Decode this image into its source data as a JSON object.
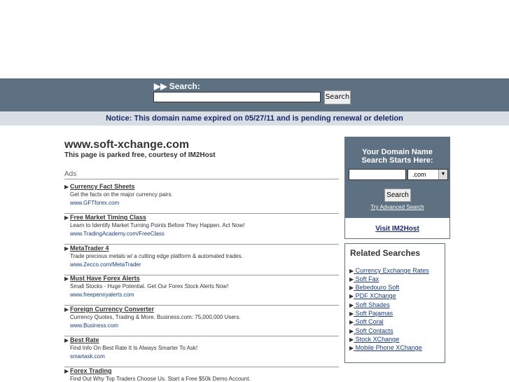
{
  "search": {
    "label": "▶▶ Search:",
    "input_value": "",
    "button_label": "Search"
  },
  "notice": "Notice: This domain name expired on 05/27/11 and is pending renewal or deletion",
  "site": {
    "title": "www.soft-xchange.com",
    "subtitle": "This page is parked free, courtesy of IM2Host"
  },
  "ads": {
    "label": "Ads",
    "items": [
      {
        "title": "Currency Fact Sheets",
        "desc": "Get the facts on the major currency pairs.",
        "url": "www.GFTforex.com"
      },
      {
        "title": "Free Market Timing Class",
        "desc": "Learn to Identify Market Turning Points Before They Happen. Act Now!",
        "url": "www.TradingAcademy.com/FreeClass"
      },
      {
        "title": "MetaTrader 4",
        "desc": "Trade precious metals w/ a cutting edge platform & automated trades.",
        "url": "www.Zecco.com/MetaTrader"
      },
      {
        "title": "Must Have Forex Alerts",
        "desc": "Small Stocks - Huge Potential. Get Our Forex Stock Alerts Now!",
        "url": "www.freepennyalerts.com"
      },
      {
        "title": "Foreign Currency Converter",
        "desc": "Currency Quotes, Trading & More. Business.com: 75,000,000 Users.",
        "url": "www.Business.com"
      },
      {
        "title": "Best Rate",
        "desc": "Find Info On Best Rate It Is Always Smarter To Ask!",
        "url": "smartask.com"
      },
      {
        "title": "Forex Trading",
        "desc": "Find Out Why Top Traders Choose Us. Start a Free $50k Demo Account.",
        "url": ""
      }
    ]
  },
  "domain_box": {
    "heading_line1": "Your Domain Name",
    "heading_line2": "Search Starts Here:",
    "input_value": "",
    "tld": ".com",
    "button_label": "Search",
    "advanced_link": "Try Advanced Search",
    "visit_link": "Visit IM2Host"
  },
  "related": {
    "title": "Related Searches",
    "items": [
      " Currency Exchange Rates",
      " Soft Fax",
      " Bebedouro Soft",
      " PDF XChange",
      " Soft Shades",
      " Soft Pajamas",
      " Soft Coral",
      " Soft Contacts",
      " Stock XChange",
      " Mobile Phone XChange"
    ]
  }
}
